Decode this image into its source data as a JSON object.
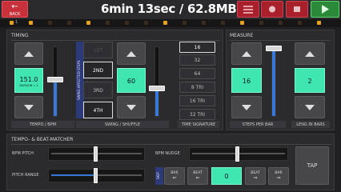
{
  "header": {
    "back_label": "BACK",
    "back_arrow": "←",
    "status": "6min 13sec / 62.8MB"
  },
  "timing": {
    "title": "TIMING",
    "tempo_value": "151.0",
    "division": "DIVISION = 1",
    "tempo_label": "TEMPO / BPM",
    "swing_vertical_label": "SWING AFFECTED STEPS",
    "swing_options": [
      "1ST",
      "2ND",
      "3RD",
      "4TH"
    ],
    "swing_value": "60",
    "swing_label": "SWING / SHUFFLE",
    "time_sig_options": [
      "16",
      "32",
      "64",
      "8 TRI",
      "16 TRI",
      "32 TRI"
    ],
    "time_sig_label": "TIME SIGNATURE"
  },
  "measure": {
    "title": "MEASURE",
    "steps_value": "16",
    "steps_label": "STEPS PER BAR",
    "len_value": "2",
    "len_label": "LENG IN BARS"
  },
  "matcher": {
    "title": "TEMPO- & BEAT-MATCHER",
    "bpm_pitch": "BPM PITCH",
    "pitch_range": "PITCH RANGE",
    "bpm_nudge": "BPM NUDGE",
    "skip": "SKIP",
    "bar": "BAR",
    "beat": "BEAT",
    "beat_value": "0",
    "tap": "TAP"
  },
  "colors": {
    "accent": "#3fe6b0",
    "back": "#c8303a",
    "slider": "#3a78d8",
    "led": "#e8a020"
  }
}
